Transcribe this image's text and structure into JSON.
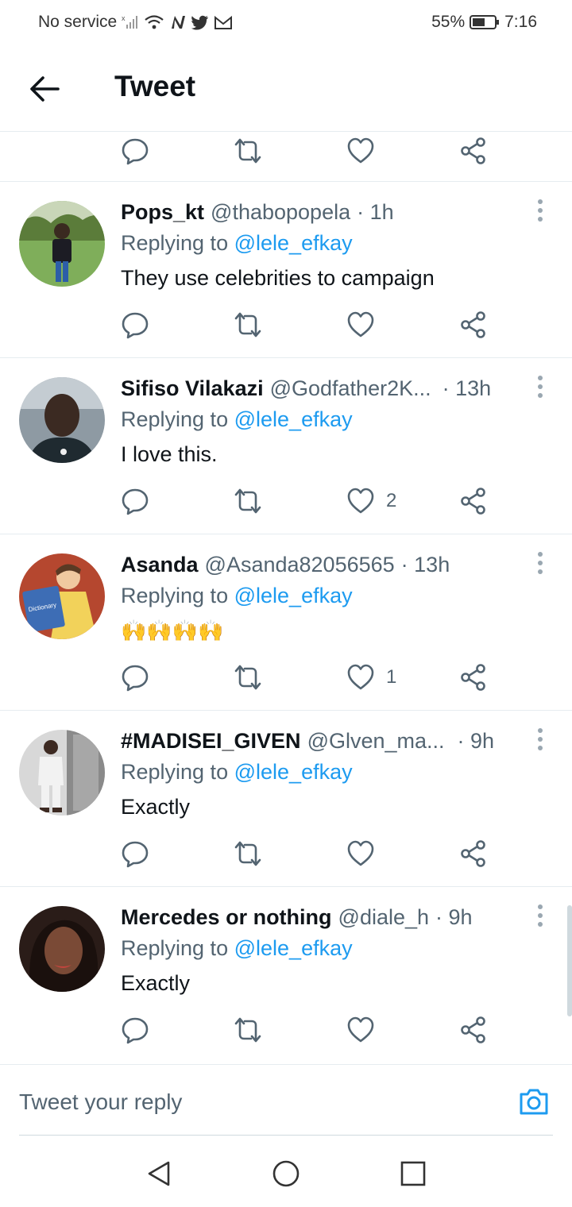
{
  "status_bar": {
    "carrier": "No service",
    "battery": "55%",
    "time": "7:16"
  },
  "header": {
    "title": "Tweet"
  },
  "tweets": [
    {
      "name": "Pops_kt",
      "handle": "@thabopopela",
      "time": "· 1h",
      "replying_prefix": "Replying to",
      "replying_to": "@lele_efkay",
      "text": "They use celebrities to campaign",
      "likes": ""
    },
    {
      "name": "Sifiso Vilakazi",
      "handle": "@Godfather2K...",
      "time": "· 13h",
      "replying_prefix": "Replying to",
      "replying_to": "@lele_efkay",
      "text": "I love this.",
      "likes": "2"
    },
    {
      "name": "Asanda",
      "handle": "@Asanda82056565",
      "time": "· 13h",
      "replying_prefix": "Replying to",
      "replying_to": "@lele_efkay",
      "text": "🙌🙌🙌🙌",
      "likes": "1"
    },
    {
      "name": "#MADISEI_GIVEN",
      "handle": "@Glven_ma...",
      "time": "· 9h",
      "replying_prefix": "Replying to",
      "replying_to": "@lele_efkay",
      "text": "Exactly",
      "likes": ""
    },
    {
      "name": "Mercedes or nothing",
      "handle": "@diale_h",
      "time": "· 9h",
      "replying_prefix": "Replying to",
      "replying_to": "@lele_efkay",
      "text": "Exactly",
      "likes": ""
    }
  ],
  "reply_bar": {
    "placeholder": "Tweet your reply"
  },
  "colors": {
    "accent": "#1d9bf0",
    "text": "#0f1419",
    "muted": "#536471",
    "divider": "#e6ecf0"
  }
}
